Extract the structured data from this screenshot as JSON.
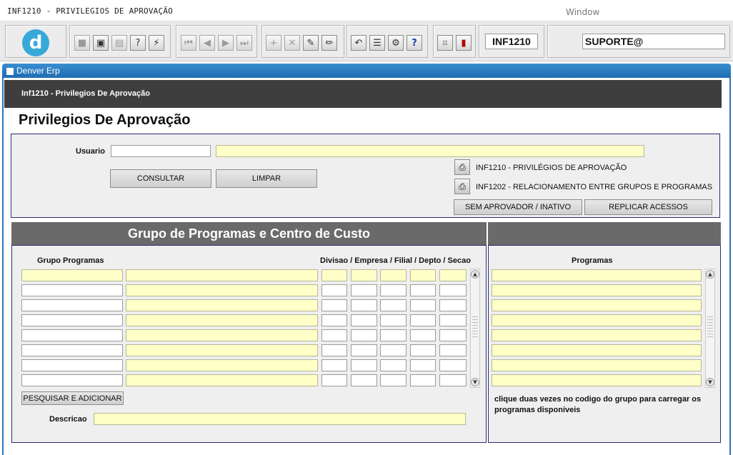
{
  "window": {
    "title": "INF1210 - PRIVILEGIOS DE APROVAÇÃO",
    "menu_window": "Window"
  },
  "toolbar": {
    "logo_letter": "d",
    "form_code": "INF1210",
    "user": "SUPORTE@",
    "icons": [
      "save-icon",
      "window-icon",
      "print-icon",
      "query-icon",
      "execute-icon",
      "first-record-icon",
      "previous-record-icon",
      "next-record-icon",
      "last-record-icon",
      "insert-record-icon",
      "delete-record-icon",
      "edit-icon",
      "clear-icon",
      "undo-icon",
      "list-icon",
      "tools-icon",
      "help-icon",
      "menu-icon",
      "exit-icon"
    ]
  },
  "app": {
    "name": "Denver Erp",
    "form_header": "Inf1210 - Privilegios De Aprovação",
    "page_title": "Privilegios De Aprovação"
  },
  "top_panel": {
    "usuario_label": "Usuario",
    "usuario_value": "",
    "usuario_name": "",
    "consultar_label": "CONSULTAR",
    "limpar_label": "LIMPAR",
    "reports": [
      {
        "label": "INF1210 - PRIVILÉGIOS DE APROVAÇÃO"
      },
      {
        "label": "INF1202 - RELACIONAMENTO ENTRE GRUPOS E PROGRAMAS"
      }
    ],
    "sem_aprovador_label": "SEM APROVADOR / INATIVO",
    "replicar_label": "REPLICAR ACESSOS"
  },
  "group_panel": {
    "header": "Grupo de Programas e Centro de Custo",
    "col_grupo": "Grupo Programas",
    "col_divisao": "Divisao / Empresa / Filial / Depto / Secao",
    "rows": 8,
    "pesquisar_label": "PESQUISAR E ADICIONAR",
    "descricao_label": "Descricao",
    "descricao_value": ""
  },
  "programs_panel": {
    "header": "",
    "col_programas": "Programas",
    "rows": 8,
    "hint": "clique duas vezes no codigo do grupo para carregar os programas disponiveis"
  },
  "colors": {
    "accent_blue": "#1f6db3",
    "field_yellow": "#ffffc8",
    "header_dark": "#3e3e3e",
    "section_gray": "#6a6a6a"
  }
}
